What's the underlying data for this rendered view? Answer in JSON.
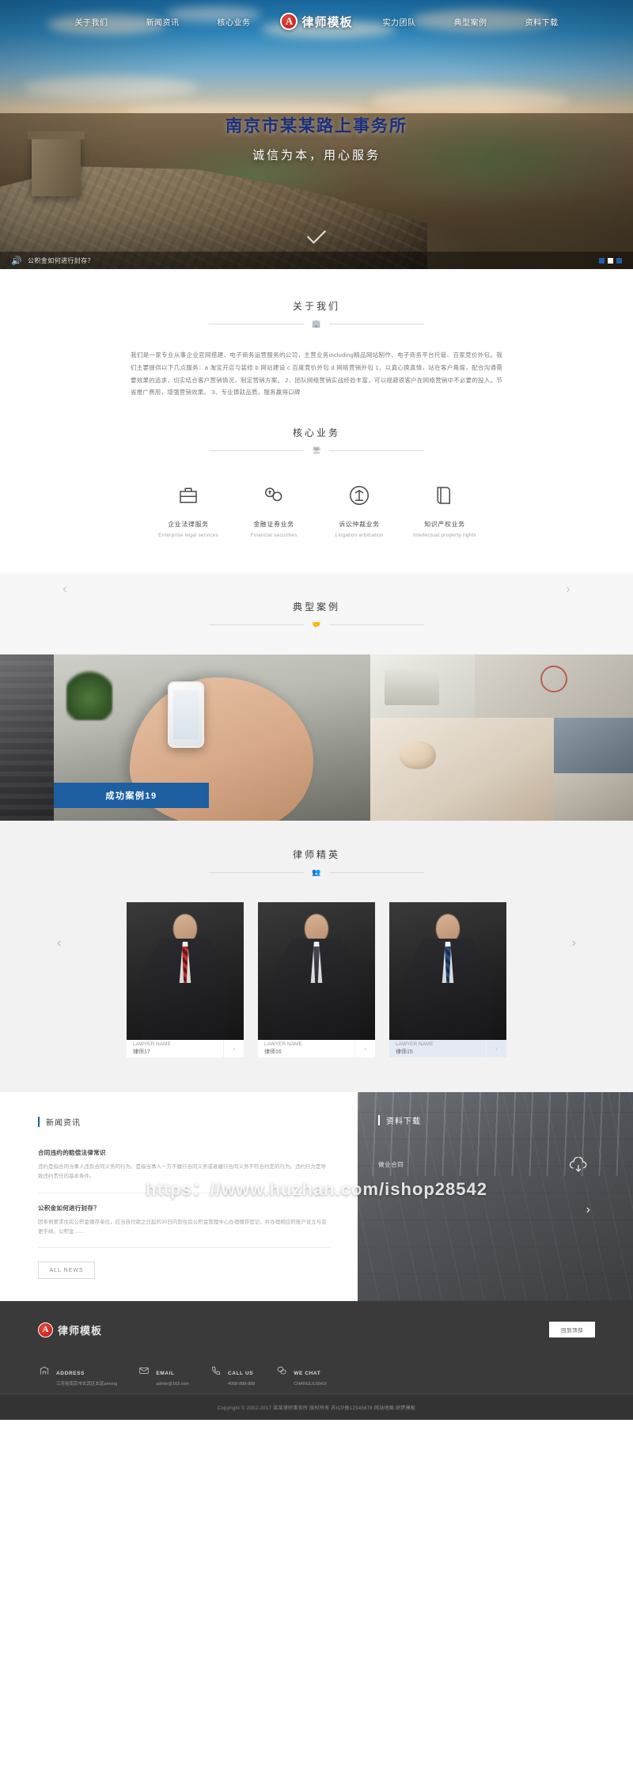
{
  "nav": {
    "left_items": [
      {
        "label": "关于我们",
        "name": "nav-about"
      },
      {
        "label": "新闻资讯",
        "name": "nav-news"
      },
      {
        "label": "核心业务",
        "name": "nav-core"
      }
    ],
    "brand": {
      "logo_letter": "A",
      "text": "律师模板"
    },
    "right_items": [
      {
        "label": "实力团队",
        "name": "nav-team"
      },
      {
        "label": "典型案例",
        "name": "nav-cases"
      },
      {
        "label": "资料下载",
        "name": "nav-download"
      }
    ]
  },
  "hero": {
    "title": "南京市某某路上事务所",
    "subtitle": "诚信为本，用心服务",
    "ticker_text": "公积金如何进行封存？",
    "slide_dots": 3,
    "active_dot": 2
  },
  "about": {
    "heading": "关于我们",
    "paragraph": "我们是一家专业从事企业官网搭建、电子商务运营服务的公司，主营业务including精品网站制作、电子商务平台托管、百家竞价外包。我们主要提供以下几点服务：a 淘宝开店与装修 b 网站建设 c 百度竞价外包 d 网络营销外包 1、以真心换真情，站在客户角度，配合沟通需要效果的追求，切实结合客户营销情况，制定营销方案。 2、团队网络营销实战经验丰富，可以规避很客户在网络营销中不必要的投入。节省推广费用，增强营销效果。 3、专业铸就品质，服务赢得口碑"
  },
  "core": {
    "heading": "核心业务",
    "items": [
      {
        "cn": "企业法律服务",
        "en": "Enterprise legal services",
        "icon": "briefcase-icon"
      },
      {
        "cn": "金融证券业务",
        "en": "Financial securities",
        "icon": "coins-icon"
      },
      {
        "cn": "诉讼仲裁业务",
        "en": "Litigation arbitration",
        "icon": "gavel-icon"
      },
      {
        "cn": "知识产权业务",
        "en": "Intellectual property rights",
        "icon": "book-icon"
      }
    ]
  },
  "cases": {
    "heading": "典型案例",
    "label": "成功案例19"
  },
  "lawyers": {
    "heading": "律师精英",
    "items": [
      {
        "en": "LAWYER NAME",
        "cn": "律师17",
        "active": false
      },
      {
        "en": "LAWYER NAME",
        "cn": "律师16",
        "active": false
      },
      {
        "en": "LAWYER NAME",
        "cn": "律师15",
        "active": true
      }
    ]
  },
  "news": {
    "heading": "新闻资讯",
    "items": [
      {
        "title": "合同违约的赔偿法律常识",
        "desc": "违约是指合同当事人违反合同义务的行为。是指当事人一方不履行合同义务或者履行合同义务不符合约定的行为。违约行为是导致违约责任的基本条件。"
      },
      {
        "title": "公积金如何进行封存？",
        "desc": "因条例要求住房公积金缴存单位，应当自付款之日起的30日内到住房公积金管理中心办理缴存登记，并办理相应的账户设立与变更手续。公积金……"
      }
    ],
    "all_button": "ALL NEWS"
  },
  "download": {
    "heading": "资料下载",
    "file_name": "做业合同",
    "cloud_icon": "cloud-download-icon",
    "next_icon": "chevron-right-icon"
  },
  "footer": {
    "brand": {
      "logo_letter": "A",
      "text": "律师模板"
    },
    "back_to_top": "回到顶部",
    "contacts": [
      {
        "icon": "address-icon",
        "label": "ADDRESS",
        "value": "江苏省南京市玄武区玄武among"
      },
      {
        "icon": "email-icon",
        "label": "EMAIL",
        "value": "admin@163.com"
      },
      {
        "icon": "phone-icon",
        "label": "CALL US",
        "value": "4008-888-888"
      },
      {
        "icon": "wechat-icon",
        "label": "WE CHAT",
        "value": "CHANGLIUSHUI"
      }
    ],
    "copyright": "Copyright © 2002-2017 某某律师事务所 版权所有  苏ICP备12345678  网站地图  织梦模板"
  },
  "watermark": "https：//www.huzhan.com/ishop28542"
}
